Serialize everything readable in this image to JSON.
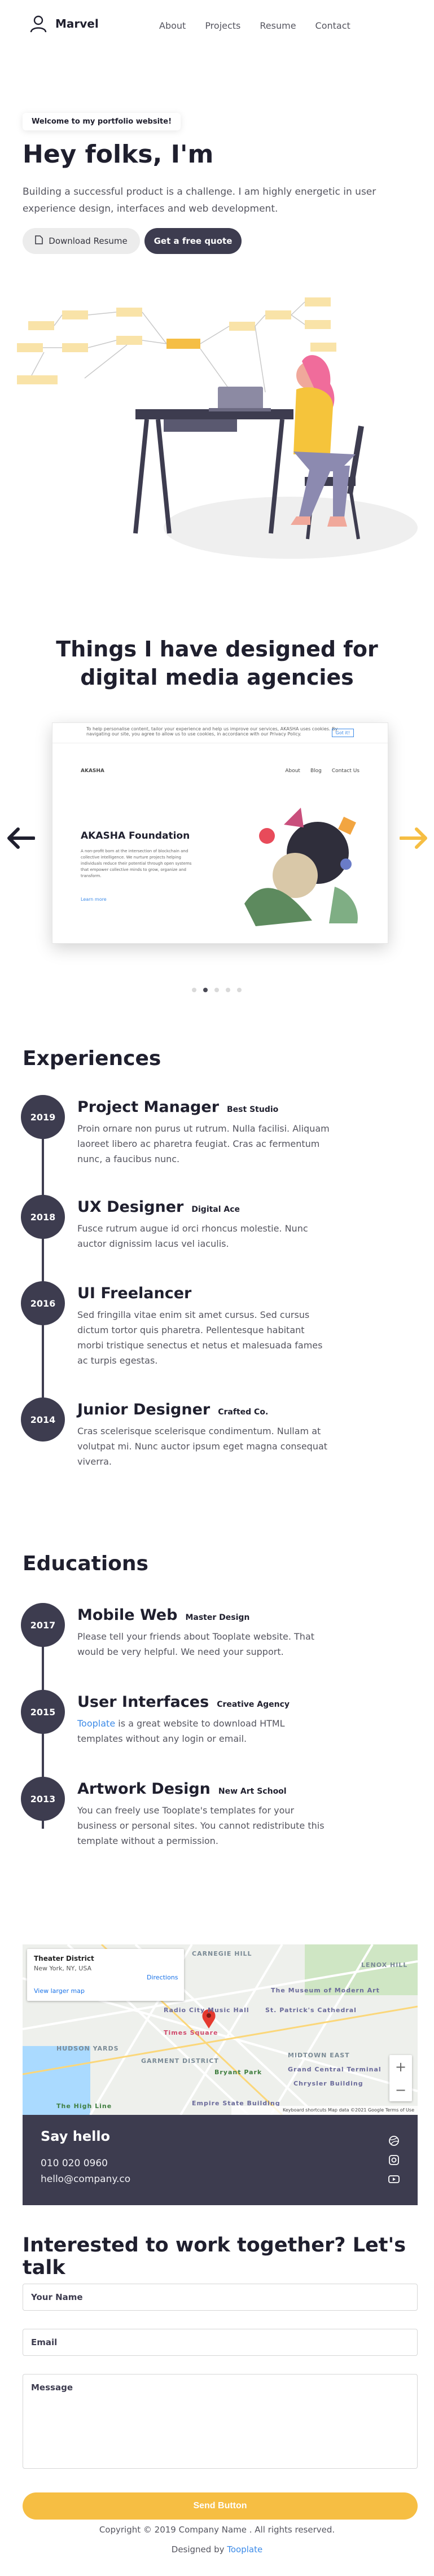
{
  "nav": {
    "brand": "Marvel",
    "links": [
      "About",
      "Projects",
      "Resume",
      "Contact"
    ]
  },
  "hero": {
    "badge": "Welcome to my portfolio website!",
    "title": "Hey folks, I'm",
    "text": "Building a successful product is a challenge. I am highly energetic in user experience design, interfaces and web development.",
    "btn_resume": "Download Resume",
    "btn_quote": "Get a free quote"
  },
  "portfolio": {
    "title": "Things I have designed for digital media agencies",
    "card": {
      "cookie_text": "To help personalise content, tailor your experience and help us improve our services, AKASHA uses cookies. By navigating our site, you agree to allow us to use cookies, in accordance with our Privacy Policy.",
      "cookie_btn": "Got it!",
      "brand": "AKASHA",
      "nav_links": [
        "About",
        "Blog",
        "Contact Us"
      ],
      "title": "AKASHA Foundation",
      "desc": "A non-profit born at the intersection of blockchain and collective intelligence. We nurture projects helping individuals reduce their potential through open systems that empower collective minds to grow, organize and transform.",
      "link": "Learn more"
    },
    "dots_count": 5,
    "active_dot": 1
  },
  "experiences": {
    "title": "Experiences",
    "items": [
      {
        "year": "2019",
        "title": "Project Manager",
        "sub": "Best Studio",
        "desc": "Proin ornare non purus ut rutrum. Nulla facilisi. Aliquam laoreet libero ac pharetra feugiat. Cras ac fermentum nunc, a faucibus nunc."
      },
      {
        "year": "2018",
        "title": "UX Designer",
        "sub": "Digital Ace",
        "desc": "Fusce rutrum augue id orci rhoncus molestie. Nunc auctor dignissim lacus vel iaculis."
      },
      {
        "year": "2016",
        "title": "UI Freelancer",
        "sub": "",
        "desc": "Sed fringilla vitae enim sit amet cursus. Sed cursus dictum tortor quis pharetra. Pellentesque habitant morbi tristique senectus et netus et malesuada fames ac turpis egestas."
      },
      {
        "year": "2014",
        "title": "Junior Designer",
        "sub": "Crafted Co.",
        "desc": "Cras scelerisque scelerisque condimentum. Nullam at volutpat mi. Nunc auctor ipsum eget magna consequat viverra."
      }
    ]
  },
  "educations": {
    "title": "Educations",
    "items": [
      {
        "year": "2017",
        "title": "Mobile Web",
        "sub": "Master Design",
        "desc": "Please tell your friends about Tooplate website. That would be very helpful. We need your support."
      },
      {
        "year": "2015",
        "title": "User Interfaces",
        "sub": "Creative Agency",
        "link": "Tooplate",
        "desc": " is a great website to download HTML templates without any login or email."
      },
      {
        "year": "2013",
        "title": "Artwork Design",
        "sub": "New Art School",
        "desc": "You can freely use Tooplate's templates for your business or personal sites. You cannot redistribute this template without a permission."
      }
    ]
  },
  "map": {
    "place": "Theater District",
    "address": "New York, NY, USA",
    "directions": "Directions",
    "larger": "View larger map",
    "footer": "Keyboard shortcuts   Map data ©2021 Google   Terms of Use",
    "labels": [
      "MIDTOWN EAST",
      "GARMENT DISTRICT",
      "HUDSON YARDS",
      "LENOX HILL",
      "Times Square",
      "Radio City Music Hall",
      "Bryant Park",
      "Chrysler Building",
      "St. Patrick's Cathedral",
      "Empire State Building",
      "The High Line",
      "Grand Central Terminal",
      "The Museum of Modern Art",
      "CARNEGIE HILL"
    ]
  },
  "contact": {
    "title": "Say hello",
    "phone": "010 020 0960",
    "email": "hello@company.co"
  },
  "form": {
    "title": "Interested to work together? Let's talk",
    "name_placeholder": "Your Name",
    "email_placeholder": "Email",
    "message_placeholder": "Message",
    "send": "Send Button"
  },
  "footer": {
    "copyright": "Copyright © 2019 Company Name . All rights reserved.",
    "designed_prefix": "Designed by ",
    "designed_link": "Tooplate"
  },
  "colors": {
    "dark": "#3d3c4f",
    "accent": "#f6be43",
    "link": "#3d8be8"
  }
}
